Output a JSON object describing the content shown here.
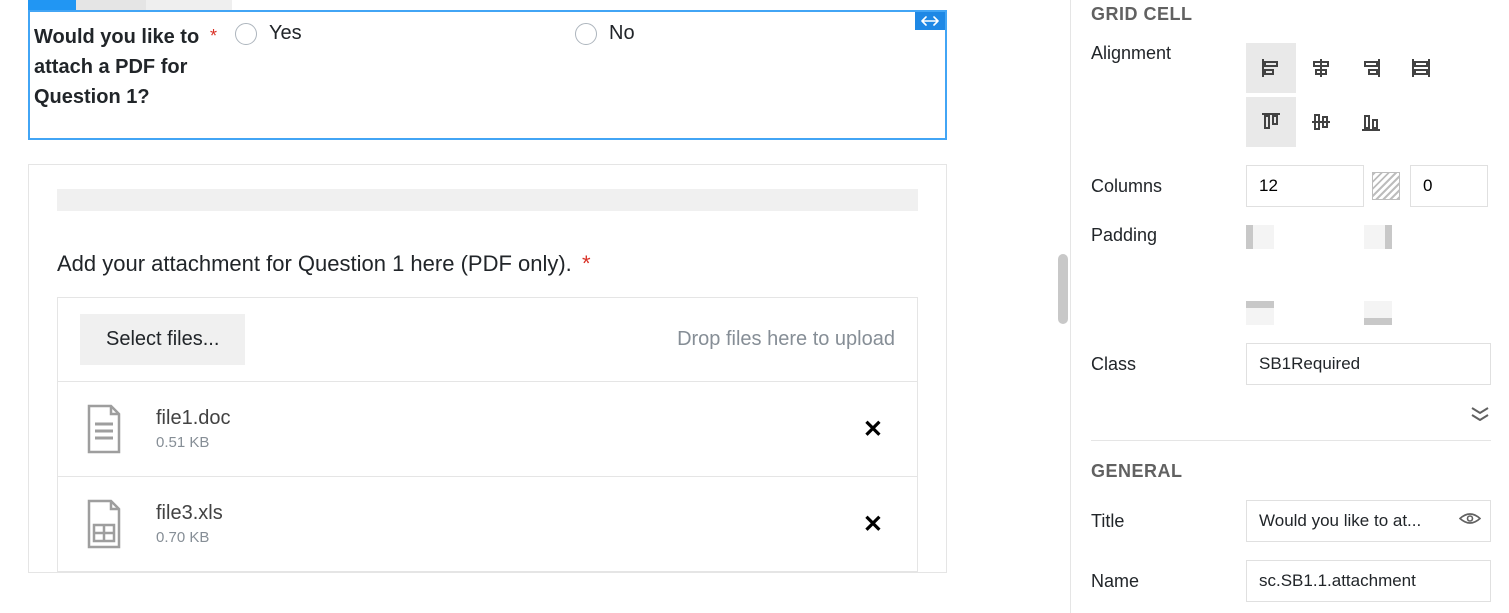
{
  "form": {
    "question_label": "Would you like to attach a PDF for Question 1?",
    "option_yes": "Yes",
    "option_no": "No",
    "attachment_heading": "Add your attachment for Question 1 here (PDF only).",
    "select_files_label": "Select files...",
    "dropzone_hint": "Drop files here to upload",
    "files": [
      {
        "name": "file1.doc",
        "size": "0.51 KB"
      },
      {
        "name": "file3.xls",
        "size": "0.70 KB"
      }
    ]
  },
  "panel": {
    "section_gridcell": "GRID CELL",
    "alignment_label": "Alignment",
    "columns_label": "Columns",
    "columns_value": "12",
    "columns_offset": "0",
    "padding_label": "Padding",
    "class_label": "Class",
    "class_value": "SB1Required",
    "section_general": "GENERAL",
    "title_label": "Title",
    "title_value": "Would you like to at...",
    "name_label": "Name",
    "name_value": "sc.SB1.1.attachment"
  }
}
